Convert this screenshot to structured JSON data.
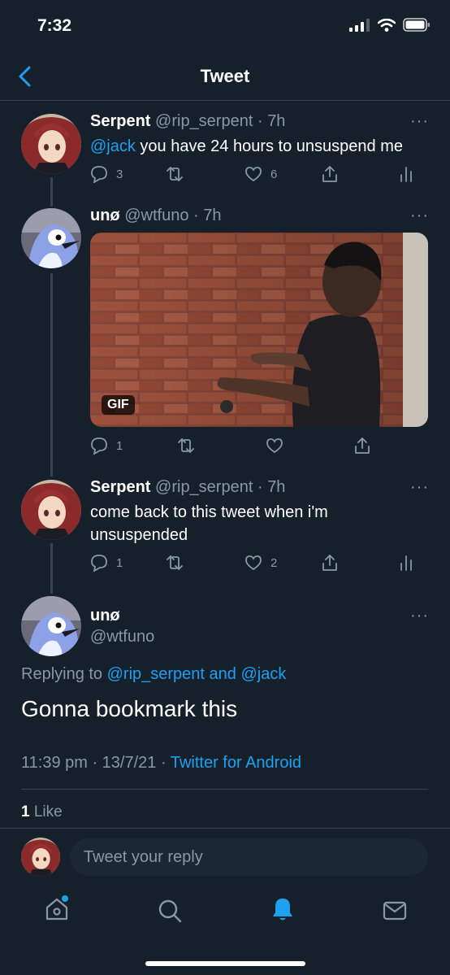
{
  "status_bar": {
    "time": "7:32"
  },
  "header": {
    "title": "Tweet"
  },
  "tweets": [
    {
      "name": "Serpent",
      "handle": "@rip_serpent",
      "time": "7h",
      "mention": "@jack",
      "text": " you have 24 hours to unsuspend me",
      "replies": "3",
      "retweets": "",
      "likes": "6"
    },
    {
      "name": "unø",
      "handle": "@wtfuno",
      "time": "7h",
      "gif_label": "GIF",
      "replies": "1",
      "retweets": "",
      "likes": ""
    },
    {
      "name": "Serpent",
      "handle": "@rip_serpent",
      "time": "7h",
      "text_line1": "come back to this tweet when i'm",
      "text_line2": "unsuspended",
      "replies": "1",
      "retweets": "",
      "likes": "2"
    }
  ],
  "main_tweet": {
    "name": "unø",
    "handle": "@wtfuno",
    "replying_prefix": "Replying to ",
    "replying_user1": "@rip_serpent",
    "replying_and": " and ",
    "replying_user2": "@jack",
    "text": "Gonna bookmark this",
    "timestamp": "11:39 pm · 13/7/21 · ",
    "source": "Twitter for Android",
    "like_count": "1",
    "like_label": " Like"
  },
  "reply": {
    "placeholder": "Tweet your reply"
  },
  "colors": {
    "background": "#15202b",
    "accent": "#1da1f2",
    "muted": "#8899a6",
    "divider": "#38444d"
  },
  "tabbar": {
    "items": [
      "home-icon",
      "search-icon",
      "notifications-icon",
      "messages-icon"
    ],
    "active": "notifications-icon"
  }
}
